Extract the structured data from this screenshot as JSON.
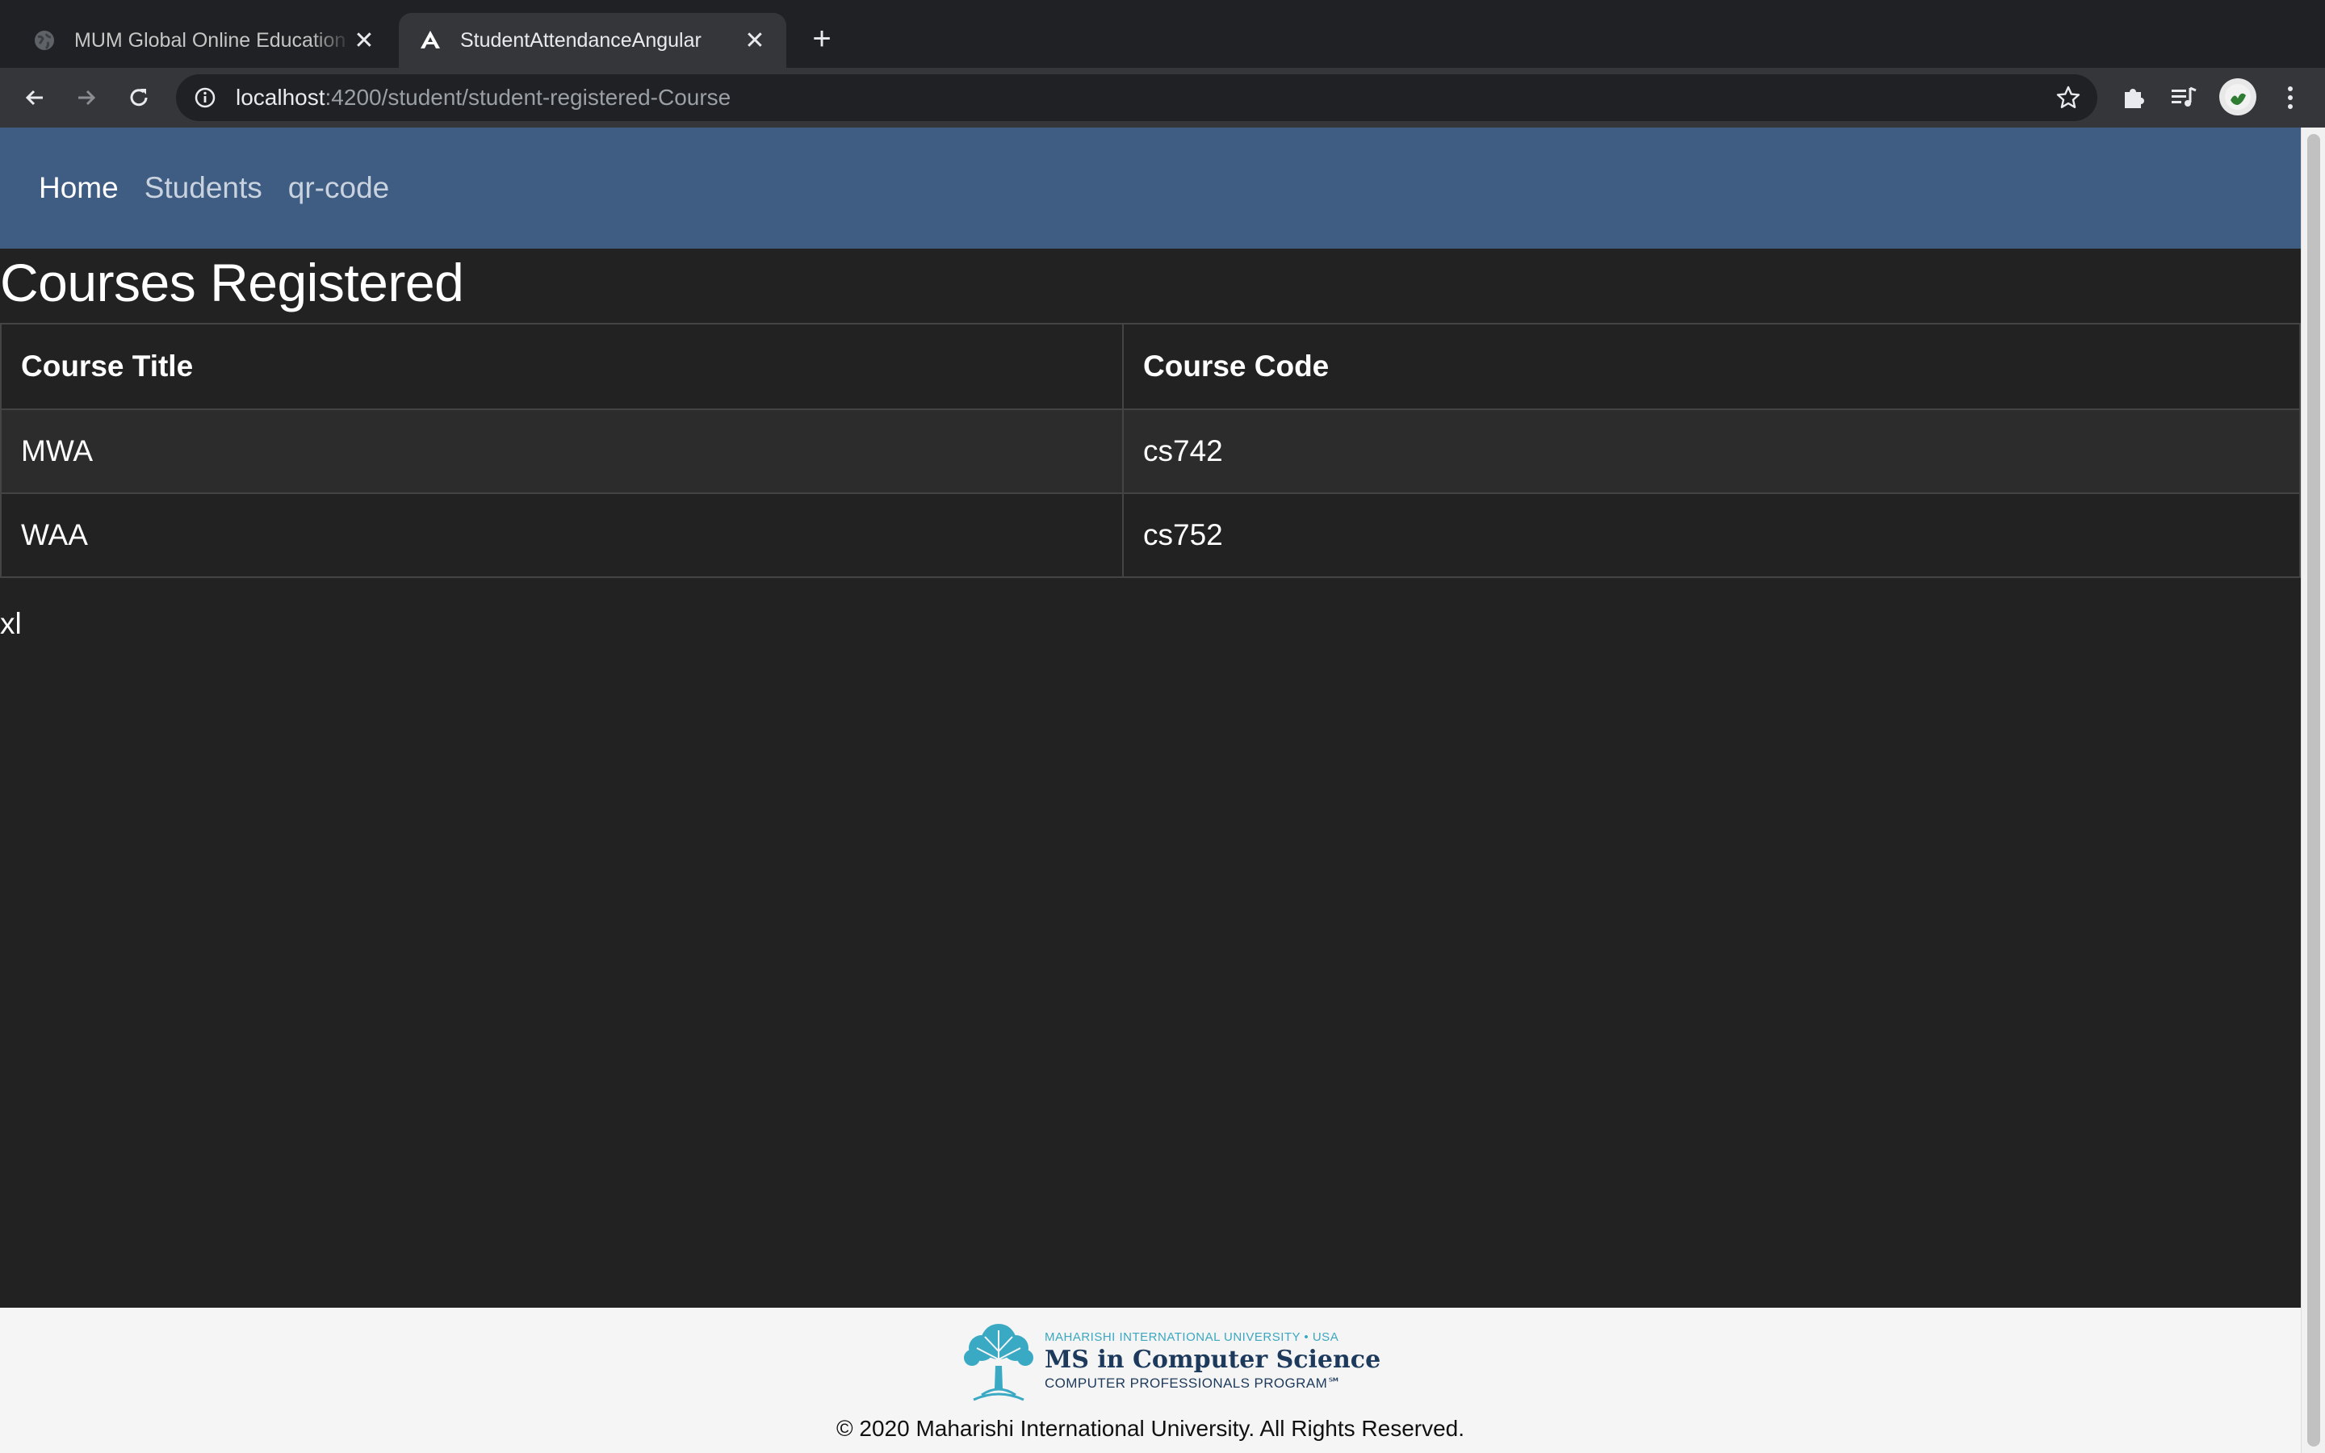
{
  "browser": {
    "tabs": [
      {
        "title": "MUM Global Online Education",
        "icon": "globe-icon",
        "active": false
      },
      {
        "title": "StudentAttendanceAngular",
        "icon": "angular-icon",
        "active": true
      }
    ],
    "url_host": "localhost",
    "url_path": ":4200/student/student-registered-Course"
  },
  "navbar": {
    "links": [
      {
        "label": "Home",
        "active": true
      },
      {
        "label": "Students",
        "active": false
      },
      {
        "label": "qr-code",
        "active": false
      }
    ],
    "color": "#3f5c82"
  },
  "page": {
    "heading": "Courses Registered",
    "table": {
      "headers": [
        "Course Title",
        "Course Code"
      ],
      "rows": [
        [
          "MWA",
          "cs742"
        ],
        [
          "WAA",
          "cs752"
        ]
      ]
    },
    "breakpoint_label": "xl"
  },
  "footer": {
    "logo": {
      "line1": "MAHARISHI INTERNATIONAL UNIVERSITY • USA",
      "line2": "MS in Computer Science",
      "line3": "COMPUTER PROFESSIONALS PROGRAM℠"
    },
    "copyright": "© 2020 Maharishi International University. All Rights Reserved."
  }
}
